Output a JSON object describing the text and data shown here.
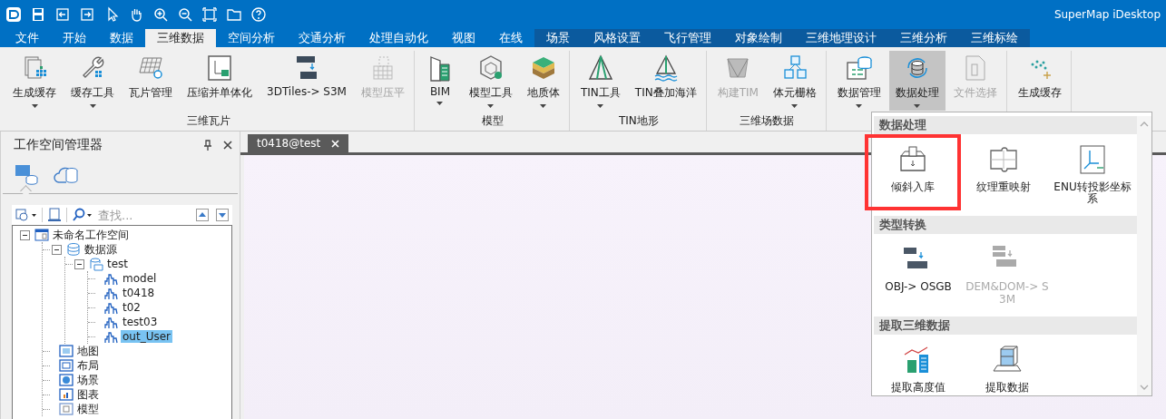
{
  "app": {
    "title": "SuperMap iDesktop"
  },
  "menu_tabs": [
    {
      "label": "文件",
      "selected": false,
      "contextual": false
    },
    {
      "label": "开始",
      "selected": false,
      "contextual": false
    },
    {
      "label": "数据",
      "selected": false,
      "contextual": false
    },
    {
      "label": "三维数据",
      "selected": true,
      "contextual": false
    },
    {
      "label": "空间分析",
      "selected": false,
      "contextual": false
    },
    {
      "label": "交通分析",
      "selected": false,
      "contextual": false
    },
    {
      "label": "处理自动化",
      "selected": false,
      "contextual": false
    },
    {
      "label": "视图",
      "selected": false,
      "contextual": false
    },
    {
      "label": "在线",
      "selected": false,
      "contextual": false
    },
    {
      "label": "场景",
      "selected": false,
      "contextual": true
    },
    {
      "label": "风格设置",
      "selected": false,
      "contextual": true
    },
    {
      "label": "飞行管理",
      "selected": false,
      "contextual": true
    },
    {
      "label": "对象绘制",
      "selected": false,
      "contextual": true
    },
    {
      "label": "三维地理设计",
      "selected": false,
      "contextual": true
    },
    {
      "label": "三维分析",
      "selected": false,
      "contextual": true
    },
    {
      "label": "三维标绘",
      "selected": false,
      "contextual": true
    }
  ],
  "ribbon_groups": [
    {
      "label": "三维瓦片",
      "buttons": [
        {
          "label": "生成缓存",
          "dropdown": true,
          "disabled": false,
          "pressed": false
        },
        {
          "label": "缓存工具",
          "dropdown": true,
          "disabled": false,
          "pressed": false
        },
        {
          "label": "瓦片管理",
          "dropdown": false,
          "disabled": false,
          "pressed": false
        },
        {
          "label": "压缩并单体化",
          "dropdown": false,
          "disabled": false,
          "pressed": false
        },
        {
          "label": "3DTiles-> S3M",
          "dropdown": false,
          "disabled": false,
          "pressed": false
        },
        {
          "label": "模型压平",
          "dropdown": false,
          "disabled": true,
          "pressed": false
        }
      ]
    },
    {
      "label": "模型",
      "buttons": [
        {
          "label": "BIM",
          "dropdown": true,
          "disabled": false,
          "pressed": false
        },
        {
          "label": "模型工具",
          "dropdown": true,
          "disabled": false,
          "pressed": false
        },
        {
          "label": "地质体",
          "dropdown": true,
          "disabled": false,
          "pressed": false
        }
      ]
    },
    {
      "label": "TIN地形",
      "buttons": [
        {
          "label": "TIN工具",
          "dropdown": true,
          "disabled": false,
          "pressed": false
        },
        {
          "label": "TIN叠加海洋",
          "dropdown": false,
          "disabled": false,
          "pressed": false
        }
      ]
    },
    {
      "label": "三维场数据",
      "buttons": [
        {
          "label": "构建TIM",
          "dropdown": false,
          "disabled": true,
          "pressed": false
        },
        {
          "label": "体元栅格",
          "dropdown": true,
          "disabled": false,
          "pressed": false
        }
      ]
    },
    {
      "buttons": [
        {
          "label": "数据管理",
          "dropdown": true,
          "disabled": false,
          "pressed": false
        },
        {
          "label": "数据处理",
          "dropdown": true,
          "disabled": false,
          "pressed": true
        },
        {
          "label": "文件选择",
          "dropdown": false,
          "disabled": true,
          "pressed": false
        }
      ]
    },
    {
      "buttons": [
        {
          "label": "生成缓存",
          "dropdown": false,
          "disabled": false,
          "pressed": false
        }
      ]
    }
  ],
  "workspace_panel": {
    "title": "工作空间管理器",
    "view_tabs": [
      {
        "selected": true
      },
      {
        "selected": false
      }
    ],
    "search": {
      "placeholder": "查找..."
    },
    "tree": [
      {
        "label": "未命名工作空间",
        "kind": "workspace",
        "expanded": true,
        "selected": false,
        "children": [
          {
            "label": "数据源",
            "kind": "datasources",
            "expanded": true,
            "selected": false,
            "children": [
              {
                "label": "test",
                "kind": "datasource",
                "expanded": true,
                "selected": false,
                "children": [
                  {
                    "label": "model",
                    "kind": "dataset",
                    "selected": false
                  },
                  {
                    "label": "t0418",
                    "kind": "dataset",
                    "selected": false
                  },
                  {
                    "label": "t02",
                    "kind": "dataset",
                    "selected": false
                  },
                  {
                    "label": "test03",
                    "kind": "dataset",
                    "selected": false
                  },
                  {
                    "label": "out_User",
                    "kind": "dataset",
                    "selected": true
                  }
                ]
              }
            ]
          },
          {
            "label": "地图",
            "kind": "maps",
            "selected": false
          },
          {
            "label": "布局",
            "kind": "layouts",
            "selected": false
          },
          {
            "label": "场景",
            "kind": "scenes",
            "selected": false
          },
          {
            "label": "图表",
            "kind": "charts",
            "selected": false
          },
          {
            "label": "模型",
            "kind": "models",
            "selected": false
          }
        ]
      }
    ]
  },
  "document_tabs": [
    {
      "label": "t0418@test",
      "selected": true
    }
  ],
  "dropdown": {
    "sections": [
      {
        "title": "数据处理",
        "items": [
          {
            "label": "倾斜入库",
            "disabled": false,
            "highlighted": true
          },
          {
            "label": "纹理重映射",
            "disabled": false,
            "highlighted": false
          },
          {
            "label": "ENU转投影坐标系",
            "disabled": false,
            "highlighted": false
          }
        ]
      },
      {
        "title": "类型转换",
        "items": [
          {
            "label": "OBJ-> OSGB",
            "disabled": false,
            "highlighted": false
          },
          {
            "label": "DEM&DOM-> S3M",
            "disabled": true,
            "highlighted": false
          }
        ]
      },
      {
        "title": "提取三维数据",
        "items": [
          {
            "label": "提取高度值",
            "disabled": false,
            "highlighted": false
          },
          {
            "label": "提取数据",
            "disabled": false,
            "highlighted": false
          }
        ]
      }
    ]
  }
}
